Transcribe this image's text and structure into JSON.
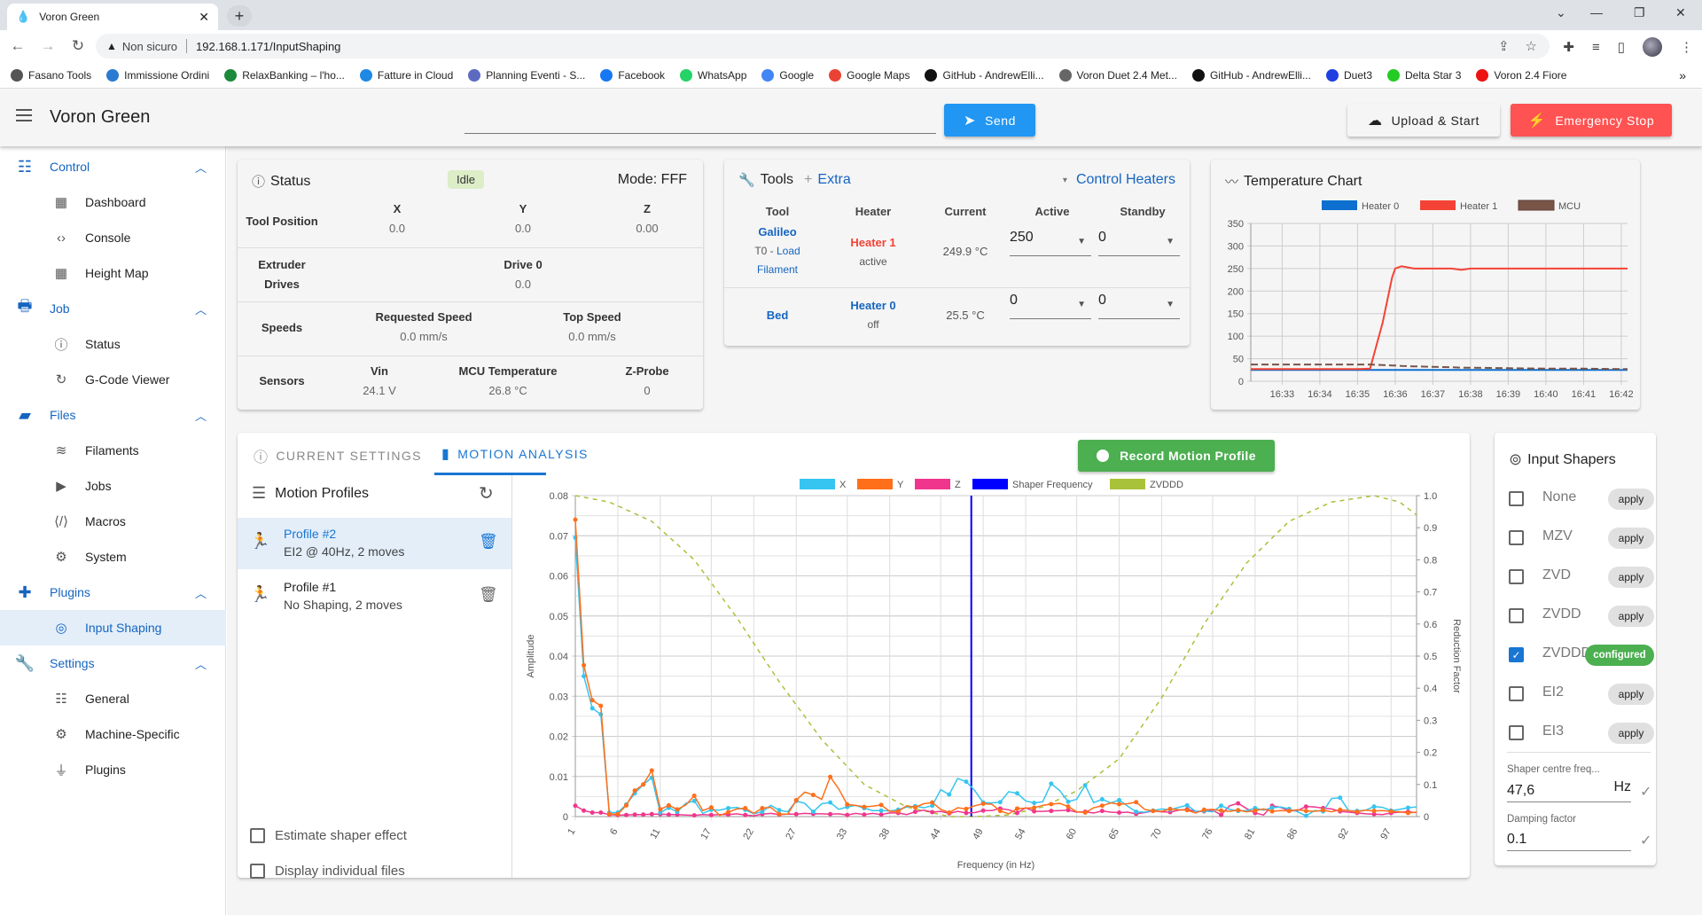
{
  "browser": {
    "tab_title": "Voron Green",
    "url_warning": "Non sicuro",
    "url": "192.168.1.171/InputShaping",
    "bookmarks": [
      {
        "label": "Fasano Tools",
        "icon": "globe-icon",
        "color": "#555555"
      },
      {
        "label": "Immissione Ordini",
        "icon": "app-icon",
        "color": "#2a7ad2"
      },
      {
        "label": "RelaxBanking – l'ho...",
        "icon": "bank-icon",
        "color": "#1b8a3a"
      },
      {
        "label": "Fatture in Cloud",
        "icon": "cloud-icon",
        "color": "#1e88e5"
      },
      {
        "label": "Planning Eventi - S...",
        "icon": "check-icon",
        "color": "#5c6bc0"
      },
      {
        "label": "Facebook",
        "icon": "facebook-icon",
        "color": "#1877f2"
      },
      {
        "label": "WhatsApp",
        "icon": "whatsapp-icon",
        "color": "#25d366"
      },
      {
        "label": "Google",
        "icon": "google-icon",
        "color": "#4285f4"
      },
      {
        "label": "Google Maps",
        "icon": "maps-pin-icon",
        "color": "#ea4335"
      },
      {
        "label": "GitHub - AndrewElli...",
        "icon": "github-icon",
        "color": "#111111"
      },
      {
        "label": "Voron Duet 2.4 Met...",
        "icon": "voron-icon",
        "color": "#666666"
      },
      {
        "label": "GitHub - AndrewElli...",
        "icon": "github-icon",
        "color": "#111111"
      },
      {
        "label": "Duet3",
        "icon": "duet-drop-icon",
        "color": "#1f3fe0"
      },
      {
        "label": "Delta Star 3",
        "icon": "delta-icon",
        "color": "#22cc22"
      },
      {
        "label": "Voron 2.4 Fiore",
        "icon": "red-circle-icon",
        "color": "#ee1111"
      }
    ],
    "more_bookmarks": "»"
  },
  "appbar": {
    "title": "Voron Green",
    "command_placeholder": "",
    "send_label": "Send",
    "upload_label": "Upload & Start",
    "estop_label": "Emergency Stop"
  },
  "sidebar": {
    "groups": [
      {
        "label": "Control",
        "icon": "tune-icon",
        "items": [
          {
            "label": "Dashboard",
            "icon": "dashboard-icon"
          },
          {
            "label": "Console",
            "icon": "code-icon"
          },
          {
            "label": "Height Map",
            "icon": "grid-icon"
          }
        ]
      },
      {
        "label": "Job",
        "icon": "printer-icon",
        "items": [
          {
            "label": "Status",
            "icon": "info-icon"
          },
          {
            "label": "G-Code Viewer",
            "icon": "3d-rotate-icon"
          }
        ]
      },
      {
        "label": "Files",
        "icon": "sd-card-icon",
        "items": [
          {
            "label": "Filaments",
            "icon": "database-icon"
          },
          {
            "label": "Jobs",
            "icon": "play-icon"
          },
          {
            "label": "Macros",
            "icon": "macro-icon"
          },
          {
            "label": "System",
            "icon": "gear-icon"
          }
        ]
      },
      {
        "label": "Plugins",
        "icon": "puzzle-icon",
        "items": [
          {
            "label": "Input Shaping",
            "icon": "rings-icon",
            "active": true
          }
        ]
      },
      {
        "label": "Settings",
        "icon": "wrench-icon",
        "items": [
          {
            "label": "General",
            "icon": "tune-icon"
          },
          {
            "label": "Machine-Specific",
            "icon": "gears-icon"
          },
          {
            "label": "Plugins",
            "icon": "plug-icon"
          }
        ]
      }
    ]
  },
  "status": {
    "title": "Status",
    "state": "Idle",
    "mode": "Mode: FFF",
    "tool_position": {
      "label": "Tool Position",
      "axes": [
        {
          "name": "X",
          "value": "0.0"
        },
        {
          "name": "Y",
          "value": "0.0"
        },
        {
          "name": "Z",
          "value": "0.00"
        }
      ]
    },
    "extruder": {
      "label_1": "Extruder",
      "label_2": "Drives",
      "drive_name": "Drive 0",
      "drive_value": "0.0"
    },
    "speeds": {
      "label": "Speeds",
      "requested_label": "Requested Speed",
      "requested_value": "0.0 mm/s",
      "top_label": "Top Speed",
      "top_value": "0.0 mm/s"
    },
    "sensors": {
      "label": "Sensors",
      "vin_label": "Vin",
      "vin_value": "24.1 V",
      "mcu_label": "MCU Temperature",
      "mcu_value": "26.8 °C",
      "zprobe_label": "Z-Probe",
      "zprobe_value": "0"
    }
  },
  "tools": {
    "title": "Tools",
    "extra_label": "Extra",
    "control_heaters_label": "Control Heaters",
    "headers": [
      "Tool",
      "Heater",
      "Current",
      "Active",
      "Standby"
    ],
    "rows": [
      {
        "tool": "Galileo",
        "tool_sub_prefix": "T0 - ",
        "tool_sub_link_1": "Load",
        "tool_sub_link_2": "Filament",
        "heater": "Heater 1",
        "heater_state": "active",
        "heater_color": "#f44336",
        "current": "249.9 °C",
        "active": "250",
        "standby": "0"
      },
      {
        "tool": "Bed",
        "heater": "Heater 0",
        "heater_state": "off",
        "heater_color": "#1565c0",
        "current": "25.5 °C",
        "active": "0",
        "standby": "0"
      }
    ]
  },
  "temperature_chart": {
    "title": "Temperature Chart",
    "legend": [
      {
        "name": "Heater 0",
        "color": "#0d6fcf",
        "dashed": false
      },
      {
        "name": "Heater 1",
        "color": "#f44336",
        "dashed": false
      },
      {
        "name": "MCU",
        "color": "#795548",
        "dashed": true
      }
    ],
    "y_ticks": [
      "0",
      "50",
      "100",
      "150",
      "200",
      "250",
      "300",
      "350"
    ],
    "x_ticks": [
      "16:33",
      "16:34",
      "16:35",
      "16:36",
      "16:37",
      "16:38",
      "16:39",
      "16:40",
      "16:41",
      "16:42"
    ]
  },
  "motion": {
    "tabs": [
      {
        "label": "CURRENT SETTINGS",
        "icon": "info-icon",
        "active": false
      },
      {
        "label": "MOTION ANALYSIS",
        "icon": "file-icon",
        "active": true
      }
    ],
    "record_label": "Record Motion Profile",
    "profiles_title": "Motion Profiles",
    "profiles": [
      {
        "name": "Profile #2",
        "desc": "EI2 @ 40Hz, 2 moves",
        "selected": true
      },
      {
        "name": "Profile #1",
        "desc": "No Shaping, 2 moves",
        "selected": false
      }
    ],
    "options": [
      {
        "label": "Estimate shaper effect",
        "checked": false
      },
      {
        "label": "Display individual files",
        "checked": false
      }
    ]
  },
  "input_shapers": {
    "title": "Input Shapers",
    "shapers": [
      {
        "name": "None",
        "checked": false,
        "action": "apply"
      },
      {
        "name": "MZV",
        "checked": false,
        "action": "apply"
      },
      {
        "name": "ZVD",
        "checked": false,
        "action": "apply"
      },
      {
        "name": "ZVDD",
        "checked": false,
        "action": "apply"
      },
      {
        "name": "ZVDDD",
        "checked": true,
        "action": "configured"
      },
      {
        "name": "EI2",
        "checked": false,
        "action": "apply"
      },
      {
        "name": "EI3",
        "checked": false,
        "action": "apply"
      }
    ],
    "freq_label": "Shaper centre freq...",
    "freq_value": "47,6",
    "freq_unit": "Hz",
    "damping_label": "Damping factor",
    "damping_value": "0.1"
  },
  "chart_data": [
    {
      "type": "line",
      "title": "Temperature Chart",
      "xlabel": "",
      "ylabel": "",
      "ylim": [
        0,
        350
      ],
      "x": [
        "16:32:10",
        "16:33",
        "16:34",
        "16:35",
        "16:35:20",
        "16:35:40",
        "16:35:55",
        "16:36",
        "16:36:10",
        "16:36:30",
        "16:37",
        "16:37:30",
        "16:37:45",
        "16:38",
        "16:39",
        "16:40",
        "16:41",
        "16:42",
        "16:42:10"
      ],
      "x_ticks": [
        "16:33",
        "16:34",
        "16:35",
        "16:36",
        "16:37",
        "16:38",
        "16:39",
        "16:40",
        "16:41",
        "16:42"
      ],
      "y_ticks": [
        0,
        50,
        100,
        150,
        200,
        250,
        300,
        350
      ],
      "grid": true,
      "legend": "top",
      "series": [
        {
          "name": "Heater 0",
          "color": "#0d6fcf",
          "values": [
            25,
            25,
            25,
            25,
            25,
            25,
            25,
            25,
            25,
            25,
            25,
            25,
            25,
            25,
            25,
            25,
            25,
            25,
            25
          ]
        },
        {
          "name": "Heater 1",
          "color": "#f44336",
          "values": [
            27,
            27,
            27,
            27,
            28,
            130,
            230,
            250,
            255,
            250,
            250,
            250,
            247,
            250,
            250,
            250,
            250,
            250,
            250
          ]
        },
        {
          "name": "MCU",
          "color": "#795548",
          "dashed": true,
          "values": [
            37,
            37,
            37,
            37,
            37,
            36,
            35,
            35,
            34,
            33,
            32,
            31,
            30,
            30,
            29,
            28,
            28,
            27,
            27
          ]
        }
      ]
    },
    {
      "type": "line",
      "title": "Motion Analysis",
      "xlabel": "Frequency (in Hz)",
      "ylabel": "Amplitude",
      "y2label": "Reduction Factor",
      "ylim": [
        0,
        0.08
      ],
      "y2lim": [
        0,
        1.0
      ],
      "y_ticks": [
        0,
        0.01,
        0.02,
        0.03,
        0.04,
        0.05,
        0.06,
        0.07,
        0.08
      ],
      "y2_ticks": [
        0,
        0.1,
        0.2,
        0.3,
        0.4,
        0.5,
        0.6,
        0.7,
        0.8,
        0.9,
        1.0
      ],
      "x_ticks": [
        1,
        6,
        11,
        17,
        22,
        27,
        33,
        38,
        44,
        49,
        54,
        60,
        65,
        70,
        76,
        81,
        86,
        92,
        97
      ],
      "xlim": [
        1,
        100
      ],
      "grid": true,
      "legend": "top",
      "shaper_frequency": 47.6,
      "freqs": [
        1,
        2,
        3,
        4,
        5,
        6,
        7,
        8,
        9,
        10,
        11,
        12,
        13,
        14,
        15,
        16,
        17,
        18,
        19,
        20,
        21,
        22,
        23,
        24,
        25,
        26,
        27,
        28,
        29,
        30,
        31,
        32,
        33,
        34,
        35,
        36,
        37,
        38,
        39,
        40,
        41,
        42,
        43,
        44,
        45,
        46,
        47,
        48,
        49,
        50,
        51,
        52,
        53,
        54,
        55,
        56,
        57,
        58,
        59,
        60,
        61,
        62,
        63,
        64,
        65,
        66,
        67,
        68,
        69,
        70,
        71,
        72,
        73,
        74,
        75,
        76,
        77,
        78,
        79,
        80,
        81,
        82,
        83,
        84,
        85,
        86,
        87,
        88,
        89,
        90,
        91,
        92,
        93,
        94,
        95,
        96,
        97,
        98,
        99,
        100
      ],
      "series": [
        {
          "name": "X",
          "color": "#36c5f0",
          "values": [
            0.0695,
            0.035,
            0.027,
            0.0255,
            0.001,
            0.001,
            0.003,
            0.0058,
            0.008,
            0.0097,
            0.001,
            0.0022,
            0.0012,
            0.0033,
            0.0039,
            0.0008,
            0.0017,
            0.0016,
            0.0021,
            0.0023,
            0.0017,
            0.0007,
            0.0012,
            0.0028,
            0.0016,
            0.0012,
            0.0039,
            0.0033,
            0.0012,
            0.0032,
            0.0035,
            0.0018,
            0.0024,
            0.0028,
            0.0021,
            0.0015,
            0.0015,
            0.0014,
            0.0017,
            0.0024,
            0.0026,
            0.0022,
            0.0027,
            0.0067,
            0.0055,
            0.0095,
            0.0087,
            0.0065,
            0.0035,
            0.0034,
            0.0036,
            0.0062,
            0.0058,
            0.0039,
            0.0034,
            0.0037,
            0.0082,
            0.0065,
            0.0037,
            0.0043,
            0.0078,
            0.0035,
            0.0043,
            0.0034,
            0.0041,
            0.0026,
            0.0012,
            0.0011,
            0.0015,
            0.0019,
            0.0017,
            0.0023,
            0.0028,
            0.0013,
            0.0014,
            0.0012,
            0.0027,
            0.0018,
            0.0014,
            0.0015,
            0.0021,
            0.0016,
            0.0022,
            0.0024,
            0.0019,
            0.0012,
            0.0002,
            0.0015,
            0.0013,
            0.0045,
            0.0047,
            0.0015,
            0.0014,
            0.0016,
            0.0025,
            0.0023,
            0.0015,
            0.0018,
            0.0022,
            0.0024
          ]
        },
        {
          "name": "Y",
          "color": "#ff6f1a",
          "values": [
            0.074,
            0.0377,
            0.029,
            0.0276,
            0.0006,
            0.0006,
            0.0028,
            0.0065,
            0.008,
            0.0115,
            0.0018,
            0.0028,
            0.0018,
            0.0029,
            0.0052,
            0.0015,
            0.0023,
            0.0003,
            0.0011,
            0.0019,
            0.0021,
            0.0008,
            0.0021,
            0.0023,
            0.0006,
            0.0006,
            0.0041,
            0.0061,
            0.0054,
            0.0043,
            0.0099,
            0.0069,
            0.003,
            0.0028,
            0.0024,
            0.0026,
            0.0029,
            0.0013,
            0.0013,
            0.0027,
            0.0023,
            0.0032,
            0.0035,
            0.0018,
            0.001,
            0.0022,
            0.0019,
            0.0027,
            0.0032,
            0.0031,
            0.0014,
            0.0007,
            0.002,
            0.0021,
            0.0022,
            0.0028,
            0.0031,
            0.0033,
            0.0025,
            0.0012,
            0.001,
            0.0022,
            0.0027,
            0.0034,
            0.0031,
            0.0032,
            0.0036,
            0.0018,
            0.0014,
            0.0013,
            0.0019,
            0.0017,
            0.0016,
            0.0009,
            0.0017,
            0.0018,
            0.0015,
            0.0013,
            0.0016,
            0.0012,
            0.0015,
            0.0019,
            0.0013,
            0.0015,
            0.0014,
            0.0017,
            0.0014,
            0.0013,
            0.0016,
            0.0012,
            0.0017,
            0.0015,
            0.0012,
            0.0016,
            0.0014,
            0.0015,
            0.0013,
            0.0012,
            0.0009,
            0.0011
          ]
        },
        {
          "name": "Z",
          "color": "#f0368c",
          "values": [
            0.0027,
            0.0015,
            0.001,
            0.001,
            0.0005,
            0.0004,
            0.0004,
            0.0005,
            0.0005,
            0.0006,
            0.0006,
            0.0005,
            0.0005,
            0.0004,
            0.0003,
            0.0005,
            0.0004,
            0.0005,
            0.0005,
            0.0007,
            0.0004,
            0.0002,
            0.0006,
            0.0008,
            0.0005,
            0.0006,
            0.0006,
            0.0008,
            0.0007,
            0.0007,
            0.0006,
            0.0007,
            0.0004,
            0.0008,
            0.0005,
            0.0008,
            0.0005,
            0.0009,
            0.0009,
            0.0005,
            0.0012,
            0.0016,
            0.0011,
            0.0013,
            0.0008,
            0.0013,
            0.0009,
            0.001,
            0.0015,
            0.0015,
            0.002,
            0.0017,
            0.0009,
            0.0022,
            0.0013,
            0.0013,
            0.0014,
            0.0015,
            0.0016,
            0.0011,
            0.0012,
            0.0009,
            0.0014,
            0.0011,
            0.001,
            0.0011,
            0.0007,
            0.001,
            0.0014,
            0.0012,
            0.0011,
            0.0016,
            0.0018,
            0.0013,
            0.0013,
            0.0016,
            0.0004,
            0.0027,
            0.0033,
            0.002,
            0.0009,
            0.0004,
            0.0027,
            0.0023,
            0.0014,
            0.0015,
            0.0025,
            0.0024,
            0.0021,
            0.0019,
            0.0013,
            0.0011,
            0.0009,
            0.0007,
            0.0006,
            0.0005,
            0.0009,
            0.0011,
            0.0012,
            0.001
          ]
        },
        {
          "name": "ZVDDD",
          "color": "#a8c23a",
          "dashed": true,
          "axis": "right",
          "values_note": "reduction factor curve",
          "x": [
            1,
            5,
            10,
            15,
            20,
            25,
            30,
            35,
            40,
            45,
            48,
            52,
            56,
            60,
            65,
            70,
            75,
            80,
            85,
            90,
            95,
            98,
            100
          ],
          "values": [
            1.0,
            0.98,
            0.92,
            0.8,
            0.62,
            0.42,
            0.24,
            0.1,
            0.03,
            0.0,
            0.0,
            0.005,
            0.03,
            0.08,
            0.18,
            0.37,
            0.6,
            0.79,
            0.92,
            0.98,
            1.0,
            0.98,
            0.94
          ]
        }
      ]
    }
  ]
}
